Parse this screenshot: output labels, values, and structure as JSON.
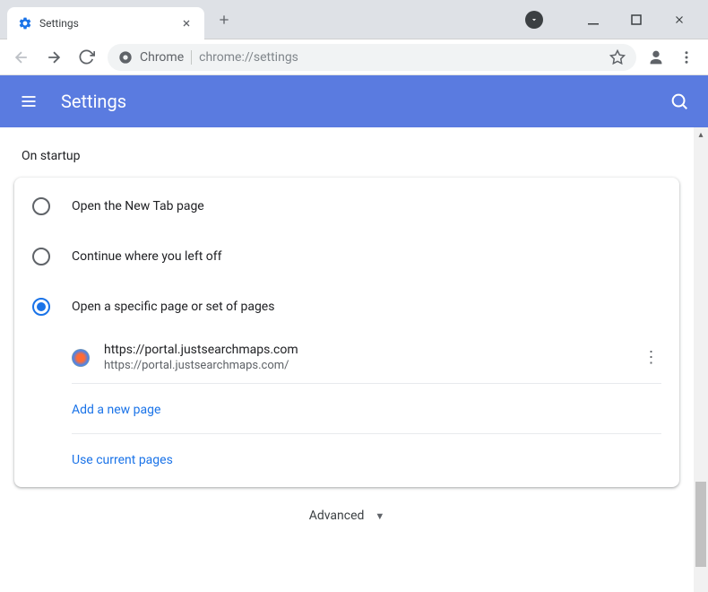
{
  "window": {
    "tab_title": "Settings"
  },
  "omnibox": {
    "scheme_label": "Chrome",
    "url": "chrome://settings"
  },
  "header": {
    "title": "Settings"
  },
  "section": {
    "title": "On startup",
    "options": {
      "new_tab": "Open the New Tab page",
      "continue": "Continue where you left off",
      "specific": "Open a specific page or set of pages"
    },
    "startup_page": {
      "title": "https://portal.justsearchmaps.com",
      "url": "https://portal.justsearchmaps.com/"
    },
    "add_page": "Add a new page",
    "use_current": "Use current pages"
  },
  "footer": {
    "advanced": "Advanced"
  }
}
